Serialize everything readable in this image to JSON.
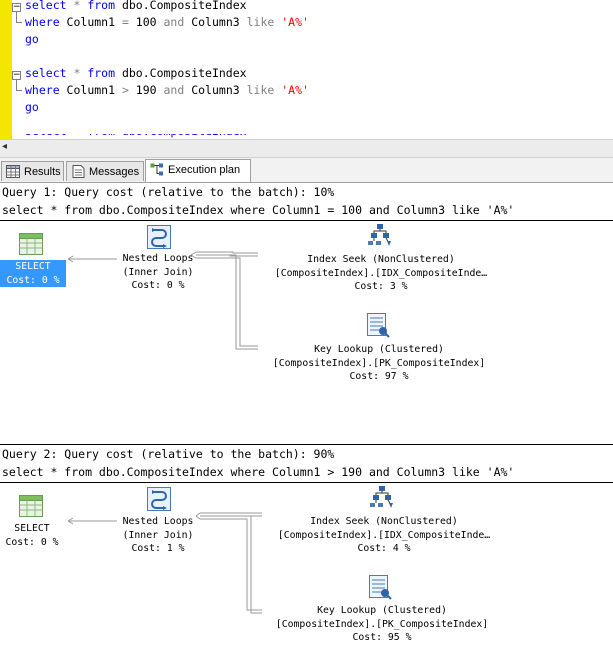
{
  "editor": {
    "lines": [
      {
        "kw1": "select",
        "star": " * ",
        "kw2": "from",
        "rest": " dbo.CompositeIndex"
      },
      {
        "kw1": "where",
        "mid1": " Column1 ",
        "op": "=",
        "num": " 100 ",
        "kw2": "and",
        "mid2": " Column3 ",
        "kw3": "like",
        "sp": " ",
        "str": "'A%'"
      },
      {
        "kw1": "go"
      },
      {
        "kw1": "select",
        "star": " * ",
        "kw2": "from",
        "rest": " dbo.CompositeIndex"
      },
      {
        "kw1": "where",
        "mid1": " Column1 ",
        "op": ">",
        "num": " 190 ",
        "kw2": "and",
        "mid2": " Column3 ",
        "kw3": "like",
        "sp": " ",
        "str": "'A%'"
      },
      {
        "kw1": "go"
      }
    ]
  },
  "tabs": [
    {
      "label": "Results",
      "icon": "grid-icon"
    },
    {
      "label": "Messages",
      "icon": "messages-icon"
    },
    {
      "label": "Execution plan",
      "icon": "execution-plan-icon",
      "active": true
    }
  ],
  "queries": [
    {
      "header": "Query 1: Query cost (relative to the batch): 10%",
      "sql": "select * from dbo.CompositeIndex where Column1 = 100 and Column3 like 'A%'",
      "nodes": {
        "select": {
          "line1": "SELECT",
          "line2": "Cost: 0 %",
          "selected": true
        },
        "nested": {
          "line1": "Nested Loops",
          "line2": "(Inner Join)",
          "line3": "Cost: 0 %"
        },
        "seek": {
          "line1": "Index Seek (NonClustered)",
          "line2": "[CompositeIndex].[IDX_CompositeInde…",
          "line3": "Cost: 3 %"
        },
        "lookup": {
          "line1": "Key Lookup (Clustered)",
          "line2": "[CompositeIndex].[PK_CompositeIndex]",
          "line3": "Cost: 97 %"
        }
      }
    },
    {
      "header": "Query 2: Query cost (relative to the batch): 90%",
      "sql": "select * from dbo.CompositeIndex where Column1 > 190 and Column3 like 'A%'",
      "nodes": {
        "select": {
          "line1": "SELECT",
          "line2": "Cost: 0 %",
          "selected": false
        },
        "nested": {
          "line1": "Nested Loops",
          "line2": "(Inner Join)",
          "line3": "Cost: 1 %"
        },
        "seek": {
          "line1": "Index Seek (NonClustered)",
          "line2": "[CompositeIndex].[IDX_CompositeInde…",
          "line3": "Cost: 4 %"
        },
        "lookup": {
          "line1": "Key Lookup (Clustered)",
          "line2": "[CompositeIndex].[PK_CompositeIndex]",
          "line3": "Cost: 95 %"
        }
      }
    }
  ],
  "colors": {
    "selection": "#3399ff",
    "keyword": "#0000ff",
    "string": "#ff0000",
    "gutter": "#f3e600"
  }
}
